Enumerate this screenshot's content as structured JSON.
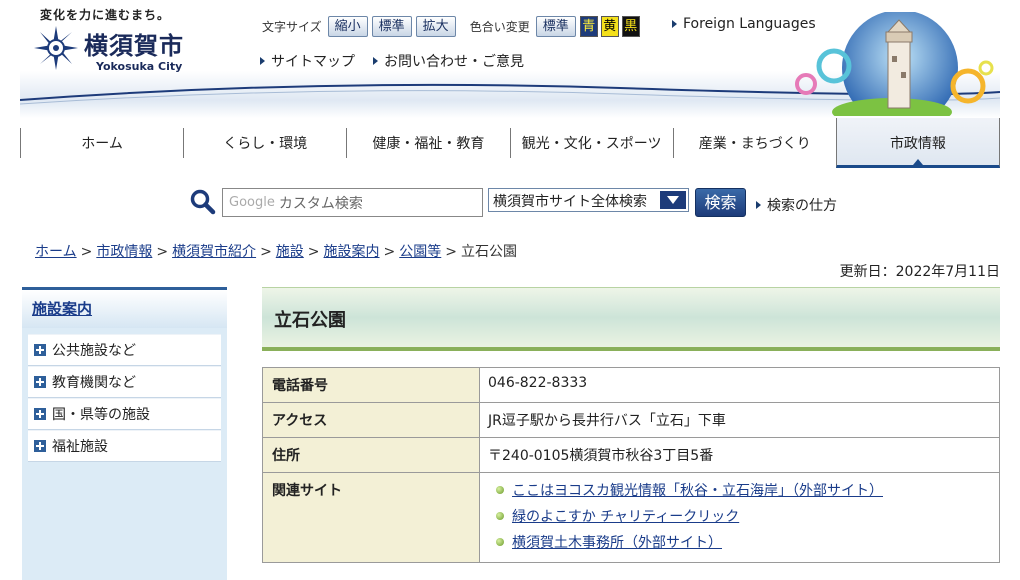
{
  "header": {
    "tagline": "変化を力に進むまち。",
    "city_name": "横須賀市",
    "city_romaji": "Yokosuka City",
    "font_size_label": "文字サイズ",
    "font_size_buttons": [
      "縮小",
      "標準",
      "拡大"
    ],
    "color_label": "色合い変更",
    "color_buttons": [
      "標準",
      "青",
      "黄",
      "黒"
    ],
    "foreign_languages": "Foreign Languages",
    "links": [
      "サイトマップ",
      "お問い合わせ・ご意見"
    ]
  },
  "nav": {
    "items": [
      "ホーム",
      "くらし・環境",
      "健康・福祉・教育",
      "観光・文化・スポーツ",
      "産業・まちづくり",
      "市政情報"
    ],
    "active_index": 5
  },
  "search": {
    "placeholder": "カスタム検索",
    "google_label": "Google",
    "scope": "横須賀市サイト全体検索",
    "button": "検索",
    "howto": "検索の仕方"
  },
  "breadcrumb": {
    "links": [
      "ホーム",
      "市政情報",
      "横須賀市紹介",
      "施設",
      "施設案内",
      "公園等"
    ],
    "current": "立石公園",
    "separator": ">"
  },
  "updated": "更新日：2022年7月11日",
  "sidebar": {
    "title": "施設案内",
    "items": [
      "公共施設など",
      "教育機関など",
      "国・県等の施設",
      "福祉施設"
    ]
  },
  "main": {
    "title": "立石公園",
    "rows": [
      {
        "label": "電話番号",
        "value": "046-822-8333"
      },
      {
        "label": "アクセス",
        "value": "JR逗子駅から長井行バス「立石」下車"
      },
      {
        "label": "住所",
        "value": "〒240-0105横須賀市秋谷3丁目5番"
      }
    ],
    "related_label": "関連サイト",
    "related_links": [
      "ここはヨコスカ観光情報「秋谷・立石海岸」（外部サイト）",
      "緑のよこすか チャリティークリック",
      "横須賀土木事務所（外部サイト）"
    ]
  },
  "colors": {
    "brand_navy": "#1d3b7a",
    "link": "#1a3c8a",
    "title_band_border": "#8ab05a",
    "table_header_bg": "#f3f0d6",
    "sidebar_bg": "#dcebf6"
  }
}
